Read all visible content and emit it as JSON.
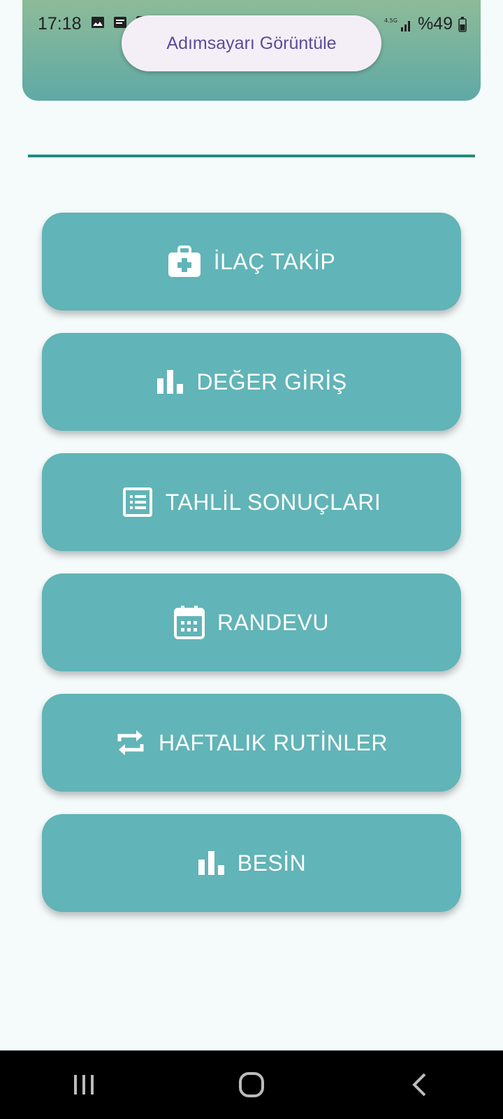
{
  "status_bar": {
    "time": "17:18",
    "battery": "%49",
    "left_icons": [
      "image-icon",
      "message-icon",
      "check-box-icon"
    ],
    "right_icons": [
      "mute-icon",
      "hotspot-icon",
      "volte-icon",
      "signal-icon",
      "battery-icon"
    ]
  },
  "header": {
    "pedometer_button": "Adımsayarı Görüntüle"
  },
  "menu": {
    "items": [
      {
        "label": "İLAÇ TAKİP",
        "icon": "medical-bag-icon"
      },
      {
        "label": "DEĞER GİRİŞ",
        "icon": "bar-chart-icon"
      },
      {
        "label": "TAHLİL SONUÇLARI",
        "icon": "list-icon"
      },
      {
        "label": "RANDEVU",
        "icon": "calendar-icon"
      },
      {
        "label": "HAFTALIK RUTİNLER",
        "icon": "repeat-icon"
      },
      {
        "label": "BESİN",
        "icon": "bar-chart-icon"
      }
    ]
  },
  "colors": {
    "button_bg": "#61b4b7",
    "divider": "#1f8b7f",
    "header_top": "#8dbb98",
    "header_bottom": "#5fa9a6",
    "pill_text": "#5e4a9b"
  },
  "nav_bar": {
    "icons": [
      "recent-apps-icon",
      "home-icon",
      "back-icon"
    ]
  }
}
